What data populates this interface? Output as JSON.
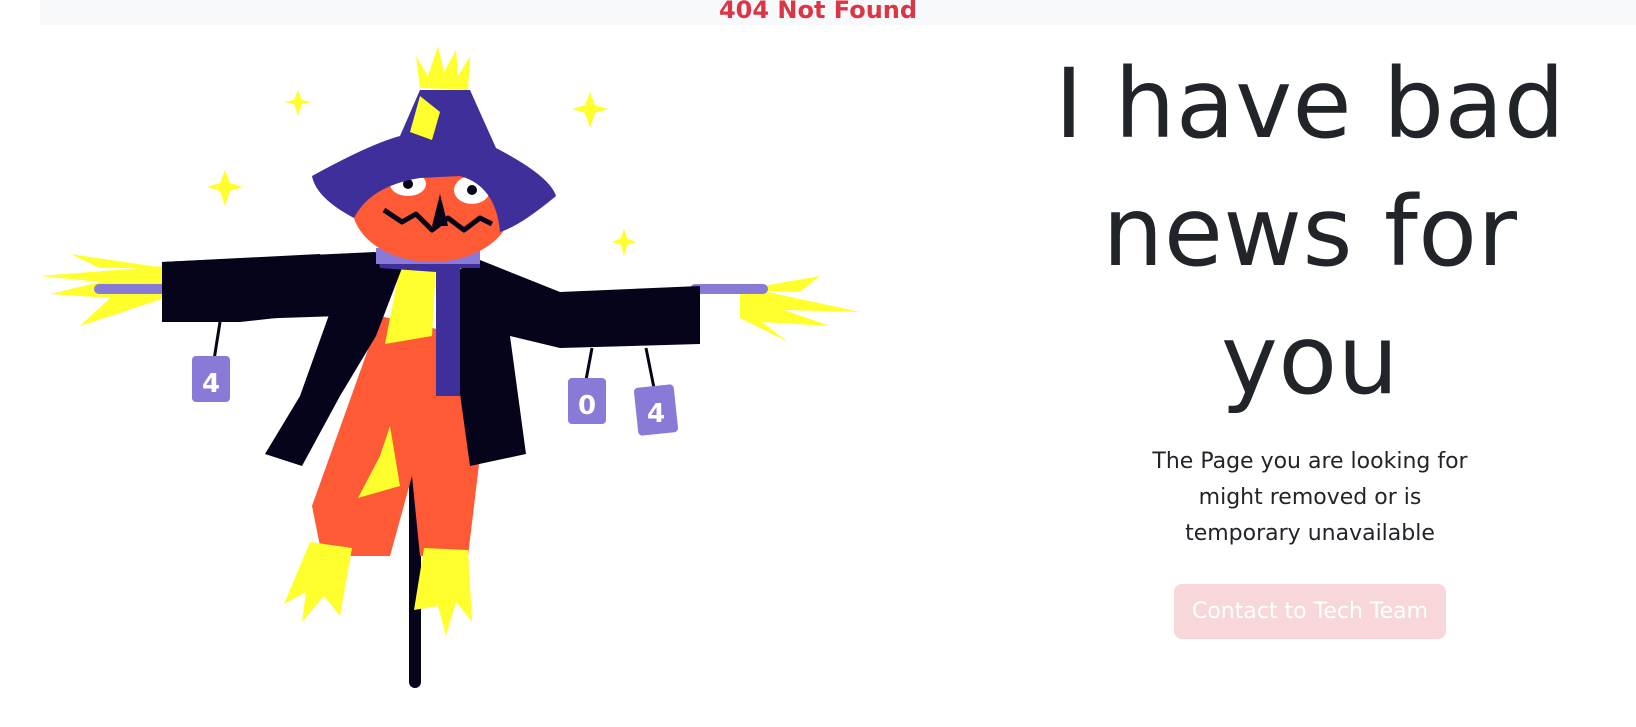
{
  "header": {
    "title": "404 Not Found"
  },
  "illustration": {
    "name": "scarecrow-404",
    "can_labels": [
      "4",
      "0",
      "4"
    ]
  },
  "main": {
    "headline": "I have bad news for you",
    "message": "The Page you are looking for might removed or is temporary unavailable",
    "contact_button_label": "Contact to Tech Team"
  },
  "colors": {
    "title_red": "#dc3545",
    "text_dark": "#212529",
    "button_bg": "#f8d7da",
    "hat_purple": "#3f2f9a",
    "can_purple": "#8a7ad8",
    "pumpkin_orange": "#ff5a36",
    "straw_yellow": "#ffff2e",
    "coat_black": "#05041a"
  }
}
